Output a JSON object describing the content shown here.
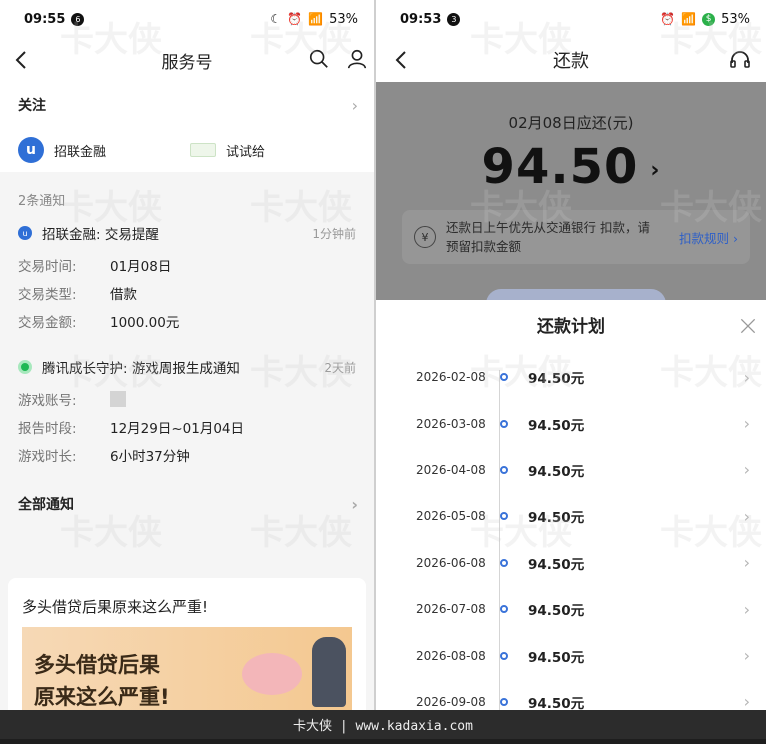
{
  "left": {
    "status": {
      "time": "09:55",
      "badge": "6",
      "battery": "53%"
    },
    "nav": {
      "title": "服务号"
    },
    "follow": {
      "label": "关注",
      "accounts": [
        {
          "name": "招联金融"
        },
        {
          "name": "试试给"
        }
      ]
    },
    "notif_count": "2条通知",
    "notifications": [
      {
        "title": "招联金融: 交易提醒",
        "ago": "1分钟前",
        "rows": [
          {
            "k": "交易时间:",
            "v": "01月08日"
          },
          {
            "k": "交易类型:",
            "v": "借款"
          },
          {
            "k": "交易金额:",
            "v": "1000.00元"
          }
        ]
      },
      {
        "title": "腾讯成长守护: 游戏周报生成通知",
        "ago": "2天前",
        "rows": [
          {
            "k": "游戏账号:",
            "v": ""
          },
          {
            "k": "报告时段:",
            "v": "12月29日~01月04日"
          },
          {
            "k": "游戏时长:",
            "v": "6小时37分钟"
          }
        ]
      }
    ],
    "all_notif": "全部通知",
    "article": {
      "title": "多头借贷后果原来这么严重!",
      "image_text_1": "多头借贷后果",
      "image_text_2": "原来这么严重!"
    }
  },
  "right": {
    "status": {
      "time": "09:53",
      "badge": "3",
      "battery": "53%"
    },
    "nav": {
      "title": "还款"
    },
    "due_date": "02月08日应还(元)",
    "due_amount": "94.50",
    "notice_text": "还款日上午优先从交通银行 扣款，请预留扣款金额",
    "notice_rule": "扣款规则",
    "plan_title": "还款计划",
    "plan": [
      {
        "date": "2026-02-08",
        "amount": "94.50元"
      },
      {
        "date": "2026-03-08",
        "amount": "94.50元"
      },
      {
        "date": "2026-04-08",
        "amount": "94.50元"
      },
      {
        "date": "2026-05-08",
        "amount": "94.50元"
      },
      {
        "date": "2026-06-08",
        "amount": "94.50元"
      },
      {
        "date": "2026-07-08",
        "amount": "94.50元"
      },
      {
        "date": "2026-08-08",
        "amount": "94.50元"
      },
      {
        "date": "2026-09-08",
        "amount": "94.50元"
      }
    ]
  },
  "watermark": {
    "brand": "卡大侠",
    "url": "www.kadaxia.com"
  },
  "bottom_bar": "卡大侠 | www.kadaxia.com",
  "colors": {
    "accent_blue": "#3a73d9",
    "link_blue": "#2d5fc8",
    "overlay_gray": "#8c8c8c"
  }
}
